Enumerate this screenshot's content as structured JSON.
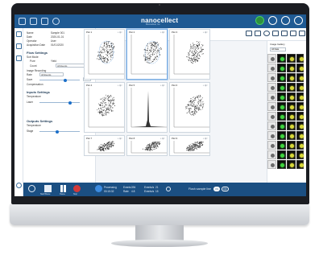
{
  "app": {
    "logo": "nanocellect",
    "logo_sub": "Biomedical, Inc.",
    "brand_color": "#1f5a93",
    "accent_color": "#1b6fc9"
  },
  "topbar": {
    "icons": [
      "home-icon",
      "document-icon",
      "grid-icon",
      "globe-icon"
    ],
    "right_icons": [
      "status-icon",
      "help-icon",
      "user-icon",
      "settings-icon"
    ]
  },
  "rail": {
    "items": [
      "search-icon",
      "close-icon",
      "chart-icon",
      "user-icon"
    ],
    "bottom_labels": [
      "Start",
      "Analysis"
    ]
  },
  "panel": {
    "fields": [
      {
        "label": "Name",
        "value": "Sample 001"
      },
      {
        "label": "Date",
        "value": "2020-01-01"
      },
      {
        "label": "Operator",
        "value": "User"
      },
      {
        "label": "Acquisition Date",
        "value": "01/01/2020"
      }
    ],
    "flow_settings": "Flow Settings",
    "sort_mode": "Sort Mode",
    "pure": "Pure",
    "yield": "Yield",
    "count": "Count",
    "count_value": "All Events",
    "image_recording": "Image Recording",
    "rate": "Rate",
    "rate_value": "All Events",
    "save": "Save",
    "compensation": "Compensation",
    "inputs_settings": "Inputs Settings",
    "temperature": "Temperature",
    "laser": "Laser",
    "outputs_settings": "Outputs Settings",
    "temperature2": "Temperature",
    "stage": "Stage"
  },
  "toolbar": {
    "left_tools": [
      "Polygon",
      "Rectangle",
      "Quadrant",
      "Ellipse",
      "Histogram",
      "Gate"
    ],
    "right_tools": [
      "Display",
      "Duplicate",
      "Delete",
      "Export",
      "Compare",
      "Settings",
      "Layout"
    ]
  },
  "plots": [
    {
      "title": "Plot 1"
    },
    {
      "title": "Plot 2"
    },
    {
      "title": "Plot 3"
    },
    {
      "title": "Plot 4"
    },
    {
      "title": "Plot 5"
    },
    {
      "title": "Plot 6"
    },
    {
      "title": "Plot 7"
    },
    {
      "title": "Plot 8"
    },
    {
      "title": "Plot 9"
    }
  ],
  "gallery": {
    "title": "Image Gallery",
    "select_value": "All Data"
  },
  "status": {
    "buttons": [
      "Start/Pause",
      "Pause",
      "Stop"
    ],
    "state": "Processing",
    "time": "00:15:32",
    "events_label": "Events",
    "events_value": "394",
    "rate_label": "Rate",
    "rate_value": "4.8",
    "events2_label": "Events/s",
    "events2_value": "21",
    "events3_label": "Events/s",
    "events3_value": "15",
    "flush": "Flush sample line",
    "on": "ON",
    "off": "OFF"
  }
}
